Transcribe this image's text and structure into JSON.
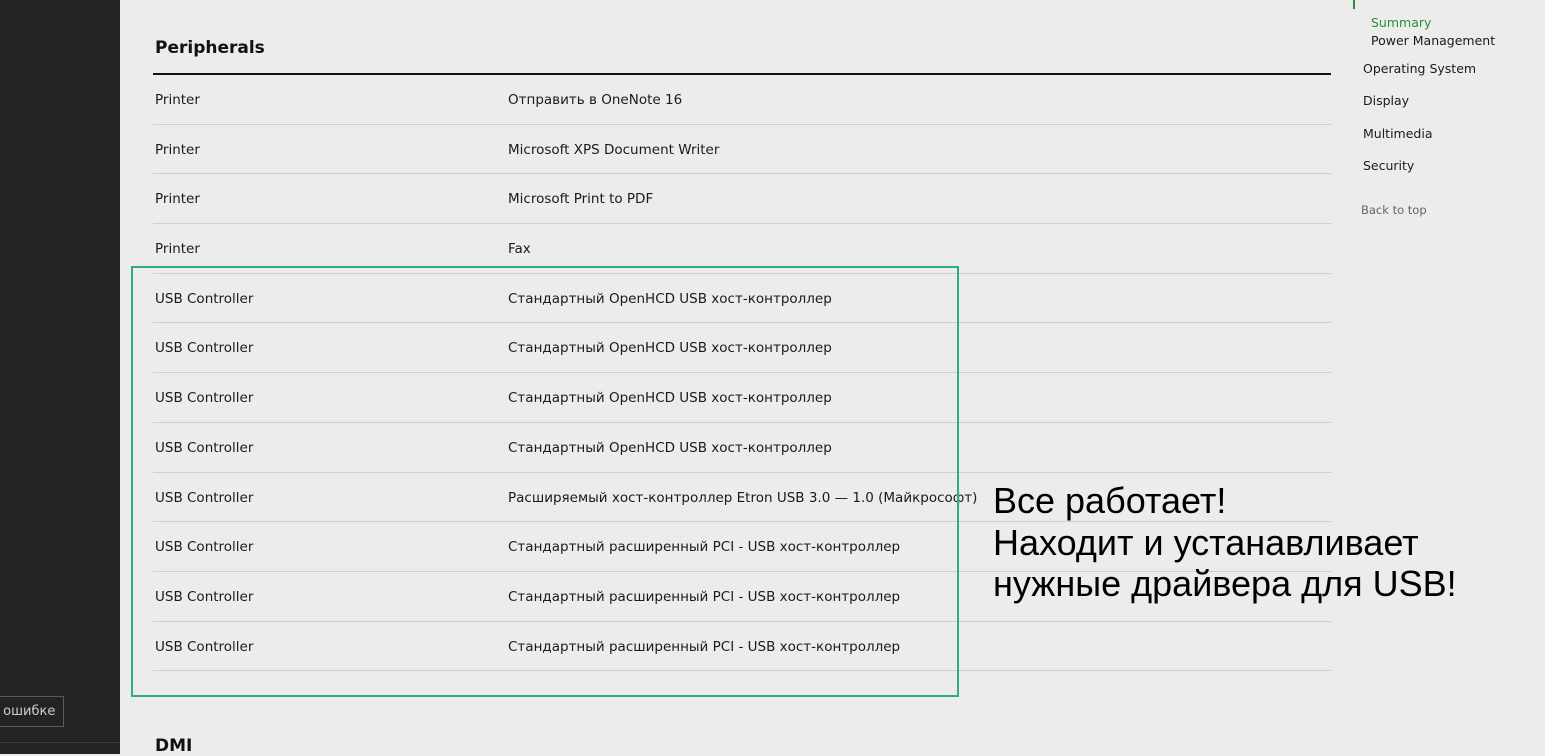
{
  "sidebar": {
    "report_button_label": "б ошибке"
  },
  "peripherals": {
    "title": "Peripherals",
    "rows": [
      {
        "type": "Printer",
        "name": "Отправить в OneNote 16"
      },
      {
        "type": "Printer",
        "name": "Microsoft XPS Document Writer"
      },
      {
        "type": "Printer",
        "name": "Microsoft Print to PDF"
      },
      {
        "type": "Printer",
        "name": "Fax"
      },
      {
        "type": "USB Controller",
        "name": "Стандартный OpenHCD USB хост-контроллер"
      },
      {
        "type": "USB Controller",
        "name": "Стандартный OpenHCD USB хост-контроллер"
      },
      {
        "type": "USB Controller",
        "name": "Стандартный OpenHCD USB хост-контроллер"
      },
      {
        "type": "USB Controller",
        "name": "Стандартный OpenHCD USB хост-контроллер"
      },
      {
        "type": "USB Controller",
        "name": "Расширяемый хост-контроллер Etron USB 3.0 — 1.0 (Майкрософт)"
      },
      {
        "type": "USB Controller",
        "name": "Стандартный расширенный PCI - USB хост-контроллер"
      },
      {
        "type": "USB Controller",
        "name": "Стандартный расширенный PCI - USB хост-контроллер"
      },
      {
        "type": "USB Controller",
        "name": "Стандартный расширенный PCI - USB хост-контроллер"
      }
    ]
  },
  "next_section": {
    "title": "DMI"
  },
  "annotation": {
    "lines": [
      "Все работает!",
      "Находит и устанавливает",
      "нужные драйвера для USB!"
    ],
    "highlight_color": "#2fae80"
  },
  "right_nav": {
    "accent_color": "#2e8b3a",
    "sub_items": [
      "Summary",
      "Power Management"
    ],
    "items": [
      "Operating System",
      "Display",
      "Multimedia",
      "Security"
    ],
    "back_to_top": "Back to top"
  }
}
